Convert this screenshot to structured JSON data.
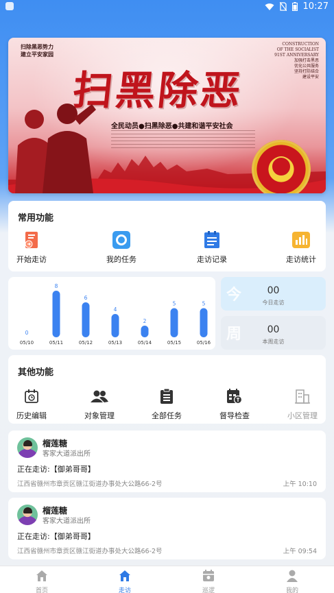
{
  "status_bar": {
    "time": "10:27"
  },
  "banner": {
    "title": "扫黑除恶",
    "corner_left": [
      "扫除黑恶势力",
      "建立平安家园"
    ],
    "corner_right": [
      "CONSTRUCTION",
      "OF THE SOCIALIST",
      "91ST ANNIVERSARY",
      "加强打击黑恶",
      "优化公共服务",
      "坚持打防结合",
      "建设平安"
    ],
    "slogan": "全民动员●扫黑除恶●共建和谐平安社会"
  },
  "common_functions": {
    "title": "常用功能",
    "items": [
      {
        "label": "开始走访",
        "icon": "start-visit-icon",
        "color": "#f36b4a"
      },
      {
        "label": "我的任务",
        "icon": "my-task-icon",
        "color": "#3a9bef"
      },
      {
        "label": "走访记录",
        "icon": "visit-record-icon",
        "color": "#2f7ae5"
      },
      {
        "label": "走访统计",
        "icon": "visit-stats-icon",
        "color": "#f6b431"
      }
    ]
  },
  "chart_data": {
    "type": "bar",
    "categories": [
      "05/10",
      "05/11",
      "05/12",
      "05/13",
      "05/14",
      "05/15",
      "05/16"
    ],
    "values": [
      0,
      8,
      6,
      4,
      2,
      5,
      5
    ],
    "title": "",
    "xlabel": "",
    "ylabel": "",
    "ylim": [
      0,
      8
    ],
    "bar_color": "#3b82f0",
    "grid": false
  },
  "stats": {
    "today": {
      "bg_char": "今",
      "value": "00",
      "caption": "今日走访"
    },
    "week": {
      "bg_char": "周",
      "value": "00",
      "caption": "本周走访"
    }
  },
  "other_functions": {
    "title": "其他功能",
    "items": [
      {
        "label": "历史编辑",
        "icon": "history-edit-icon",
        "enabled": true
      },
      {
        "label": "对象管理",
        "icon": "object-management-icon",
        "enabled": true
      },
      {
        "label": "全部任务",
        "icon": "all-tasks-icon",
        "enabled": true
      },
      {
        "label": "督导检查",
        "icon": "supervision-check-icon",
        "enabled": true
      },
      {
        "label": "小区管理",
        "icon": "community-management-icon",
        "enabled": false
      }
    ]
  },
  "visits": [
    {
      "name": "榴莲糖",
      "dept": "客家大道派出所",
      "status": "正在走访:【御弟哥哥】",
      "address": "江西省赣州市章贡区赣江街道办事处大公路66-2号",
      "time": "上午 10:10"
    },
    {
      "name": "榴莲糖",
      "dept": "客家大道派出所",
      "status": "正在走访:【御弟哥哥】",
      "address": "江西省赣州市章贡区赣江街道办事处大公路66-2号",
      "time": "上午 09:54"
    }
  ],
  "bottom_nav": [
    {
      "label": "首页",
      "icon": "home-icon",
      "active": false
    },
    {
      "label": "走访",
      "icon": "visit-home-icon",
      "active": true
    },
    {
      "label": "巡逻",
      "icon": "patrol-icon",
      "active": false
    },
    {
      "label": "我的",
      "icon": "profile-icon",
      "active": false
    }
  ],
  "colors": {
    "primary": "#2f7ae5",
    "stat_today_bg": "#daeefc",
    "stat_week_bg": "#e8edf3"
  }
}
